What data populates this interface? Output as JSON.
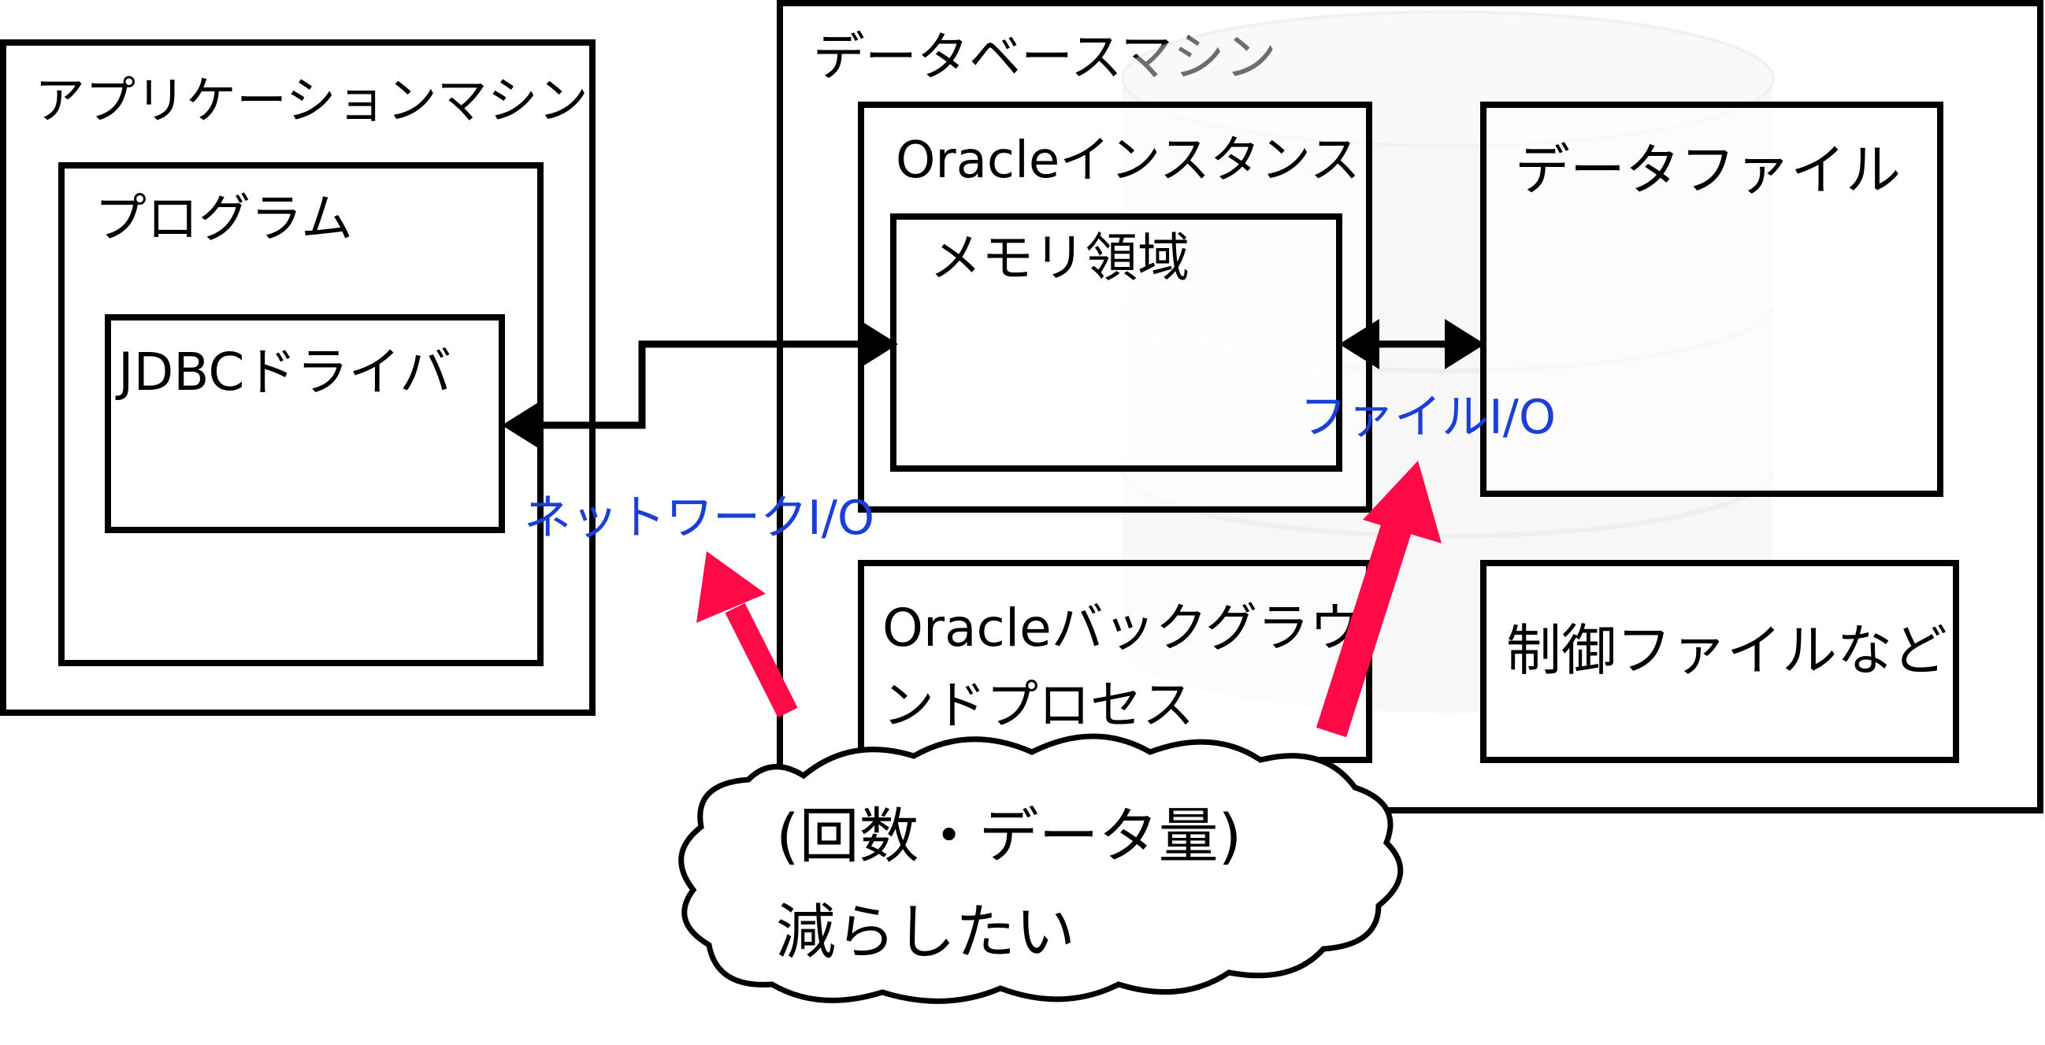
{
  "app_machine": {
    "title": "アプリケーションマシン",
    "program": {
      "title": "プログラム",
      "driver": "JDBCドライバ"
    }
  },
  "db_machine": {
    "title": "データベースマシン",
    "instance": {
      "title": "Oracleインスタンス",
      "memory": "メモリ領域"
    },
    "background_process": {
      "line1": "Oracleバックグラウ",
      "line2": "ンドプロセス"
    },
    "datafile": "データファイル",
    "control_files": "制御ファイルなど"
  },
  "labels": {
    "network_io": "ネットワークI/O",
    "file_io": "ファイルI/O"
  },
  "callout": {
    "line1": "(回数・データ量)",
    "line2": "減らしたい"
  },
  "colors": {
    "io_label": "#1a3ed8",
    "highlight_arrow": "#ff0a46",
    "line": "#000000"
  },
  "icons": {
    "background": "database-cylinder-icon"
  }
}
